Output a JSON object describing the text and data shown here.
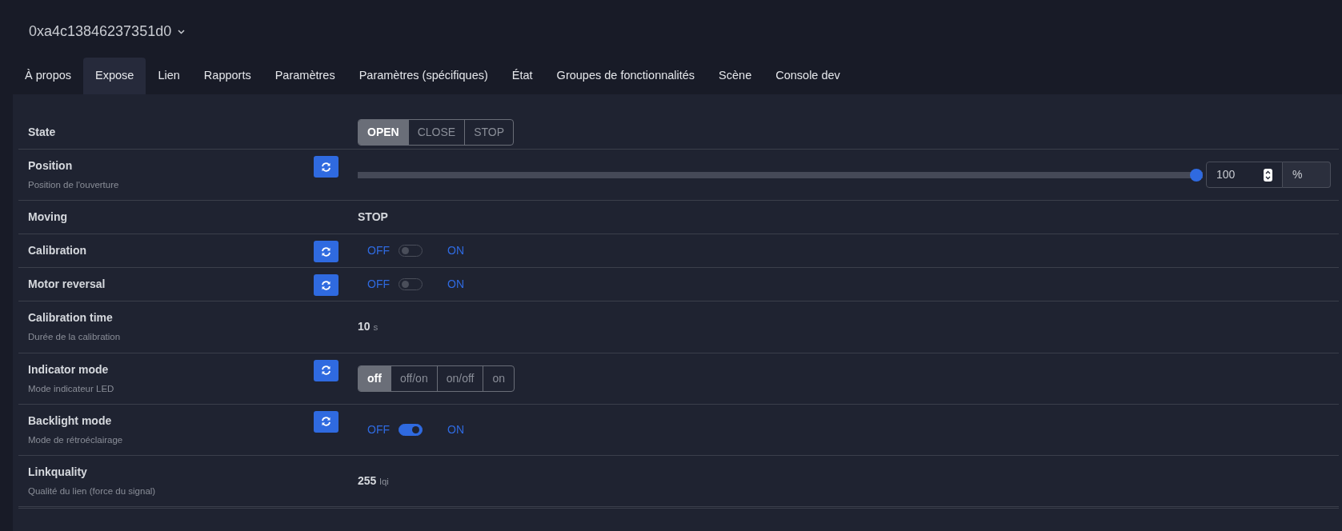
{
  "device": {
    "name": "0xa4c13846237351d0"
  },
  "tabs": [
    {
      "label": "À propos",
      "selected": false
    },
    {
      "label": "Expose",
      "selected": true
    },
    {
      "label": "Lien",
      "selected": false
    },
    {
      "label": "Rapports",
      "selected": false
    },
    {
      "label": "Paramètres",
      "selected": false
    },
    {
      "label": "Paramètres (spécifiques)",
      "selected": false
    },
    {
      "label": "État",
      "selected": false
    },
    {
      "label": "Groupes de fonctionnalités",
      "selected": false
    },
    {
      "label": "Scène",
      "selected": false
    },
    {
      "label": "Console dev",
      "selected": false
    }
  ],
  "features": [
    {
      "kind": "enum",
      "label": "State",
      "refresh": false,
      "options": [
        {
          "label": "OPEN",
          "selected": true
        },
        {
          "label": "CLOSE",
          "selected": false
        },
        {
          "label": "STOP",
          "selected": false
        }
      ]
    },
    {
      "kind": "slider",
      "label": "Position",
      "description": "Position de l'ouverture",
      "refresh": true,
      "level": 1,
      "value": "100",
      "unit": "%"
    },
    {
      "kind": "text",
      "label": "Moving",
      "refresh": false,
      "value": "STOP"
    },
    {
      "kind": "toggle",
      "label": "Calibration",
      "refresh": true,
      "off_label": "OFF",
      "on_label": "ON",
      "on": false
    },
    {
      "kind": "toggle",
      "label": "Motor reversal",
      "refresh": true,
      "off_label": "OFF",
      "on_label": "ON",
      "on": false
    },
    {
      "kind": "numeric",
      "label": "Calibration time",
      "description": "Durée de la calibration",
      "refresh": false,
      "value": "10",
      "unit": "s"
    },
    {
      "kind": "enum",
      "label": "Indicator mode",
      "description": "Mode indicateur LED",
      "refresh": true,
      "options": [
        {
          "label": "off",
          "selected": true
        },
        {
          "label": "off/on",
          "selected": false
        },
        {
          "label": "on/off",
          "selected": false
        },
        {
          "label": "on",
          "selected": false
        }
      ]
    },
    {
      "kind": "toggle",
      "label": "Backlight mode",
      "description": "Mode de rétroéclairage",
      "refresh": true,
      "off_label": "OFF",
      "on_label": "ON",
      "on": true
    },
    {
      "kind": "numeric",
      "label": "Linkquality",
      "description": "Qualité du lien (force du signal)",
      "refresh": false,
      "value": "255",
      "unit": "lqi"
    }
  ]
}
